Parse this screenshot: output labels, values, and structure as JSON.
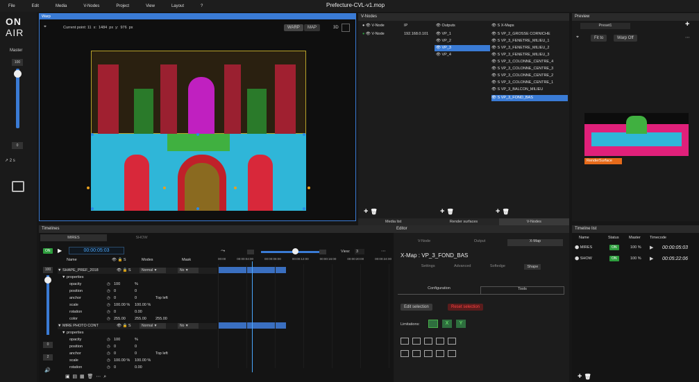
{
  "menu": [
    "File",
    "Edit",
    "Media",
    "V-Nodes",
    "Project",
    "View",
    "Layout",
    "?"
  ],
  "document_title": "Prefecture-CVL-v1.mop",
  "logo": {
    "line1": "ON",
    "line2": "AIR"
  },
  "master": {
    "label": "Master",
    "value_top": "100",
    "value_bottom": "0",
    "speed": "2 s",
    "level": 1.0
  },
  "warp": {
    "title": "Warp",
    "current_point_label": "Current point: 11",
    "x_label": "x:",
    "x_value": "1484",
    "x_unit": "px",
    "y_label": "y:",
    "y_value": "976",
    "y_unit": "px",
    "warp_btn": "WARP",
    "map_btn": "MAP",
    "threed": "3D"
  },
  "vnodes": {
    "title": "V-Nodes",
    "col_vnode": "V-Node",
    "col_ip": "IP",
    "col_outputs": "Outputs",
    "col_xmaps": "X-Maps",
    "s_label": "S",
    "node_name": "V-Node",
    "node_ip": "192.168.0.101",
    "outputs": [
      "VP_1",
      "VP_2",
      "VP_3",
      "VP_4"
    ],
    "xmaps": [
      "VP_2_GROSSE CORNICHE",
      "VP_3_FENETRE_MILIEU_1",
      "VP_3_FENETRE_MILIEU_2",
      "VP_3_FENETRE_MILIEU_3",
      "VP_3_COLONNE_CENTRE_4",
      "VP_3_COLONNE_CENTRE_3",
      "VP_3_COLONNE_CENTRE_2",
      "VP_3_COLONNE_CENTRE_1",
      "VP_3_BALCON_MILIEU",
      "VP_3_FOND_BAS"
    ],
    "bottom_tabs": [
      "Media list",
      "Render surfaces",
      "V-Nodes"
    ]
  },
  "preview": {
    "title": "Preview",
    "preset": "Preset1",
    "fit": "Fit to",
    "warp_off": "Warp Off",
    "surface_label": "RenderSurface"
  },
  "timelines": {
    "title": "Timelines",
    "tabs": [
      "MIRES",
      "SHOW"
    ],
    "on": "ON",
    "timecode": "00:00:05:03",
    "col_name": "Name",
    "col_s": "S",
    "col_modes": "Modes",
    "col_mask": "Mask",
    "view_label": "View:",
    "view_value": "3",
    "ruler": [
      "00:00",
      "00:00:04:00",
      "00:00:08:00",
      "00:00:12:00",
      "00:00:16:00",
      "00:00:20:00",
      "00:00:24:00"
    ],
    "layer1": {
      "name": "SHAPE_PREF_2018",
      "mode": "Normal",
      "mask": "No"
    },
    "layer2": {
      "name": "MIRE PHOTO CONT",
      "mode": "Normal",
      "mask": "No"
    },
    "props_label": "properties",
    "props1": [
      {
        "name": "opacity",
        "v1": "100",
        "v2": "%",
        "v3": ""
      },
      {
        "name": "position",
        "v1": "0",
        "v2": "0",
        "v3": ""
      },
      {
        "name": "anchor",
        "v1": "0",
        "v2": "0",
        "v3": "Top left"
      },
      {
        "name": "scale",
        "v1": "100.00 %",
        "v2": "100.00 %",
        "v3": ""
      },
      {
        "name": "rotation",
        "v1": "0",
        "v2": "0.00",
        "v3": ""
      },
      {
        "name": "color",
        "v1": "255.00",
        "v2": "255.00",
        "v3": "255.00"
      }
    ],
    "props2": [
      {
        "name": "opacity",
        "v1": "100",
        "v2": "%",
        "v3": ""
      },
      {
        "name": "position",
        "v1": "0",
        "v2": "0",
        "v3": ""
      },
      {
        "name": "anchor",
        "v1": "0",
        "v2": "0",
        "v3": "Top left"
      },
      {
        "name": "scale",
        "v1": "100.00 %",
        "v2": "100.00 %",
        "v3": ""
      },
      {
        "name": "rotation",
        "v1": "0",
        "v2": "0.00",
        "v3": ""
      }
    ],
    "side_values": [
      "100",
      "0",
      "2"
    ]
  },
  "editor": {
    "title": "Editor",
    "tabs": [
      "V-Node",
      "Output",
      "X-Map"
    ],
    "xmap_title": "X-Map : VP_3_FOND_BAS",
    "subtabs": [
      "Settings",
      "Advanced",
      "Softedge",
      "Shape"
    ],
    "cfg_tabs": [
      "Configuration",
      "Tools"
    ],
    "edit_selection": "Edit selection",
    "reset_selection": "Reset selection",
    "limitations": "Limitations:",
    "x": "X",
    "y": "Y"
  },
  "timeline_list": {
    "title": "Timeline list",
    "cols": [
      "Name",
      "Status",
      "Master",
      "Timecode"
    ],
    "rows": [
      {
        "name": "MIRES",
        "status": "ON",
        "master": "100 %",
        "tc": "00:00:05:03"
      },
      {
        "name": "SHOW",
        "status": "ON",
        "master": "100 %",
        "tc": "00:05:22:06"
      }
    ]
  },
  "colors": {
    "accent": "#3a7bd5",
    "on": "#2e9e3e",
    "cyan": "#2fb6d8",
    "red": "#c8283a",
    "yellow": "#d8c13a"
  }
}
